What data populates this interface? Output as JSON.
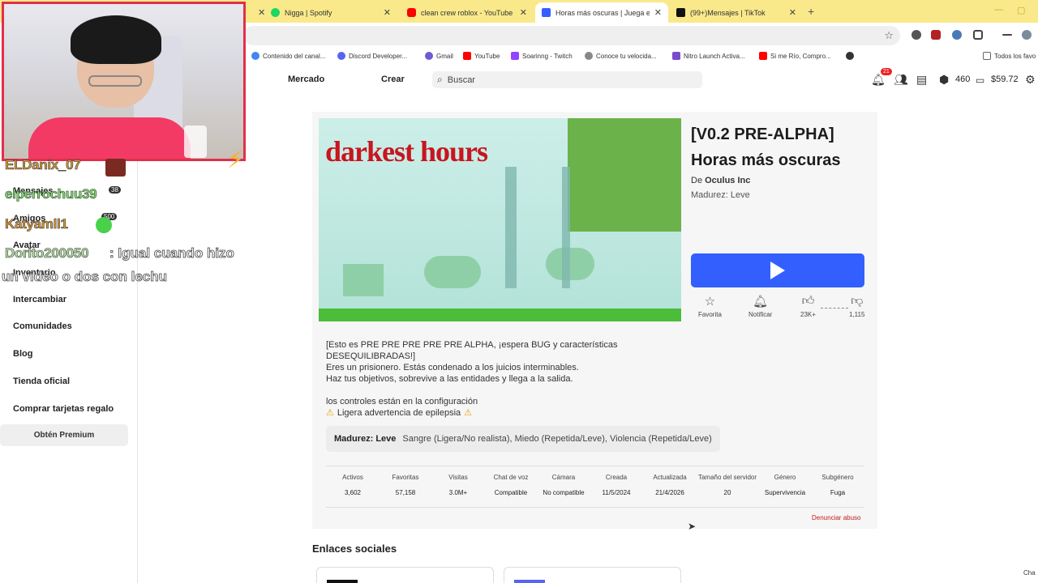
{
  "browser": {
    "tabs": [
      {
        "title": "Nigga | Spotify",
        "color": "#1ed760"
      },
      {
        "title": "clean crew roblox - YouTube",
        "color": "#ff0000"
      },
      {
        "title": "Horas más oscuras | Juega en R",
        "color": "#335fff"
      },
      {
        "title": "(99+)Mensajes | TikTok",
        "color": "#111111"
      }
    ],
    "bookmarks": [
      {
        "label": "Contenido del canal...",
        "color": "#4285f4"
      },
      {
        "label": "Discord Developer...",
        "color": "#5865f2"
      },
      {
        "label": "Gmail",
        "color": "#6b5bd6"
      },
      {
        "label": "YouTube",
        "color": "#ff0000"
      },
      {
        "label": "Soarinng - Twitch",
        "color": "#9146ff"
      },
      {
        "label": "Conoce tu velocida...",
        "color": "#888888"
      },
      {
        "label": "Nitro Launch Activa...",
        "color": "#7a4cc9"
      },
      {
        "label": "Si me Río, Compro...",
        "color": "#ff0000"
      },
      {
        "label": "Todos los favo",
        "color": "#666666"
      }
    ]
  },
  "header": {
    "nav_market": "Mercado",
    "nav_create": "Crear",
    "search_placeholder": "Buscar",
    "notif_count": "21",
    "robux": "460",
    "money": "$59.72"
  },
  "sidebar": {
    "items": [
      "Mensajes",
      "Amigos",
      "Avatar",
      "Inventario",
      "Intercambiar",
      "Comunidades",
      "Blog",
      "Tienda oficial",
      "Comprar tarjetas regalo"
    ],
    "premium": "Obtén Premium",
    "counts": [
      "38",
      "500"
    ]
  },
  "chat": {
    "names": [
      "ELDanix_07",
      "elperrochuu39",
      "Katyamll1",
      "Dorito200050"
    ],
    "message_line1": ": Igual cuando hizo",
    "message_line2": "un video o dos con lechu"
  },
  "game": {
    "thumb_text": "darkest hours",
    "title": "[V0.2 PRE-ALPHA] Horas más oscuras",
    "creator_prefix": "De",
    "creator": "Oculus Inc",
    "maturity": "Madurez: Leve",
    "actions": {
      "favorite": "Favorita",
      "notify": "Notificar",
      "likes": "23K+",
      "dislikes": "1,115"
    },
    "description": [
      "[Esto es PRE PRE PRE PRE PRE ALPHA, ¡espera BUG y características DESEQUILIBRADAS!]",
      "Eres un prisionero. Estás condenado a los juicios interminables.",
      "Haz tus objetivos, sobrevive a las entidades y llega a la salida.",
      "",
      "los controles están en la configuración"
    ],
    "warning": "Ligera advertencia de epilepsia",
    "maturity_label": "Madurez: Leve",
    "maturity_detail": "Sangre (Ligera/No realista), Miedo (Repetida/Leve), Violencia (Repetida/Leve)",
    "stats": [
      {
        "label": "Activos",
        "value": "3,602"
      },
      {
        "label": "Favoritas",
        "value": "57,158"
      },
      {
        "label": "Visitas",
        "value": "3.0M+"
      },
      {
        "label": "Chat de voz",
        "value": "Compatible"
      },
      {
        "label": "Cámara",
        "value": "No compatible"
      },
      {
        "label": "Creada",
        "value": "11/5/2024"
      },
      {
        "label": "Actualizada",
        "value": "21/4/2026"
      },
      {
        "label": "Tamaño del servidor",
        "value": "20"
      },
      {
        "label": "Género",
        "value": "Supervivencia"
      },
      {
        "label": "Subgénero",
        "value": "Fuga"
      }
    ],
    "report": "Denunciar abuso",
    "social_title": "Enlaces sociales",
    "chat_widget": "Cha"
  }
}
